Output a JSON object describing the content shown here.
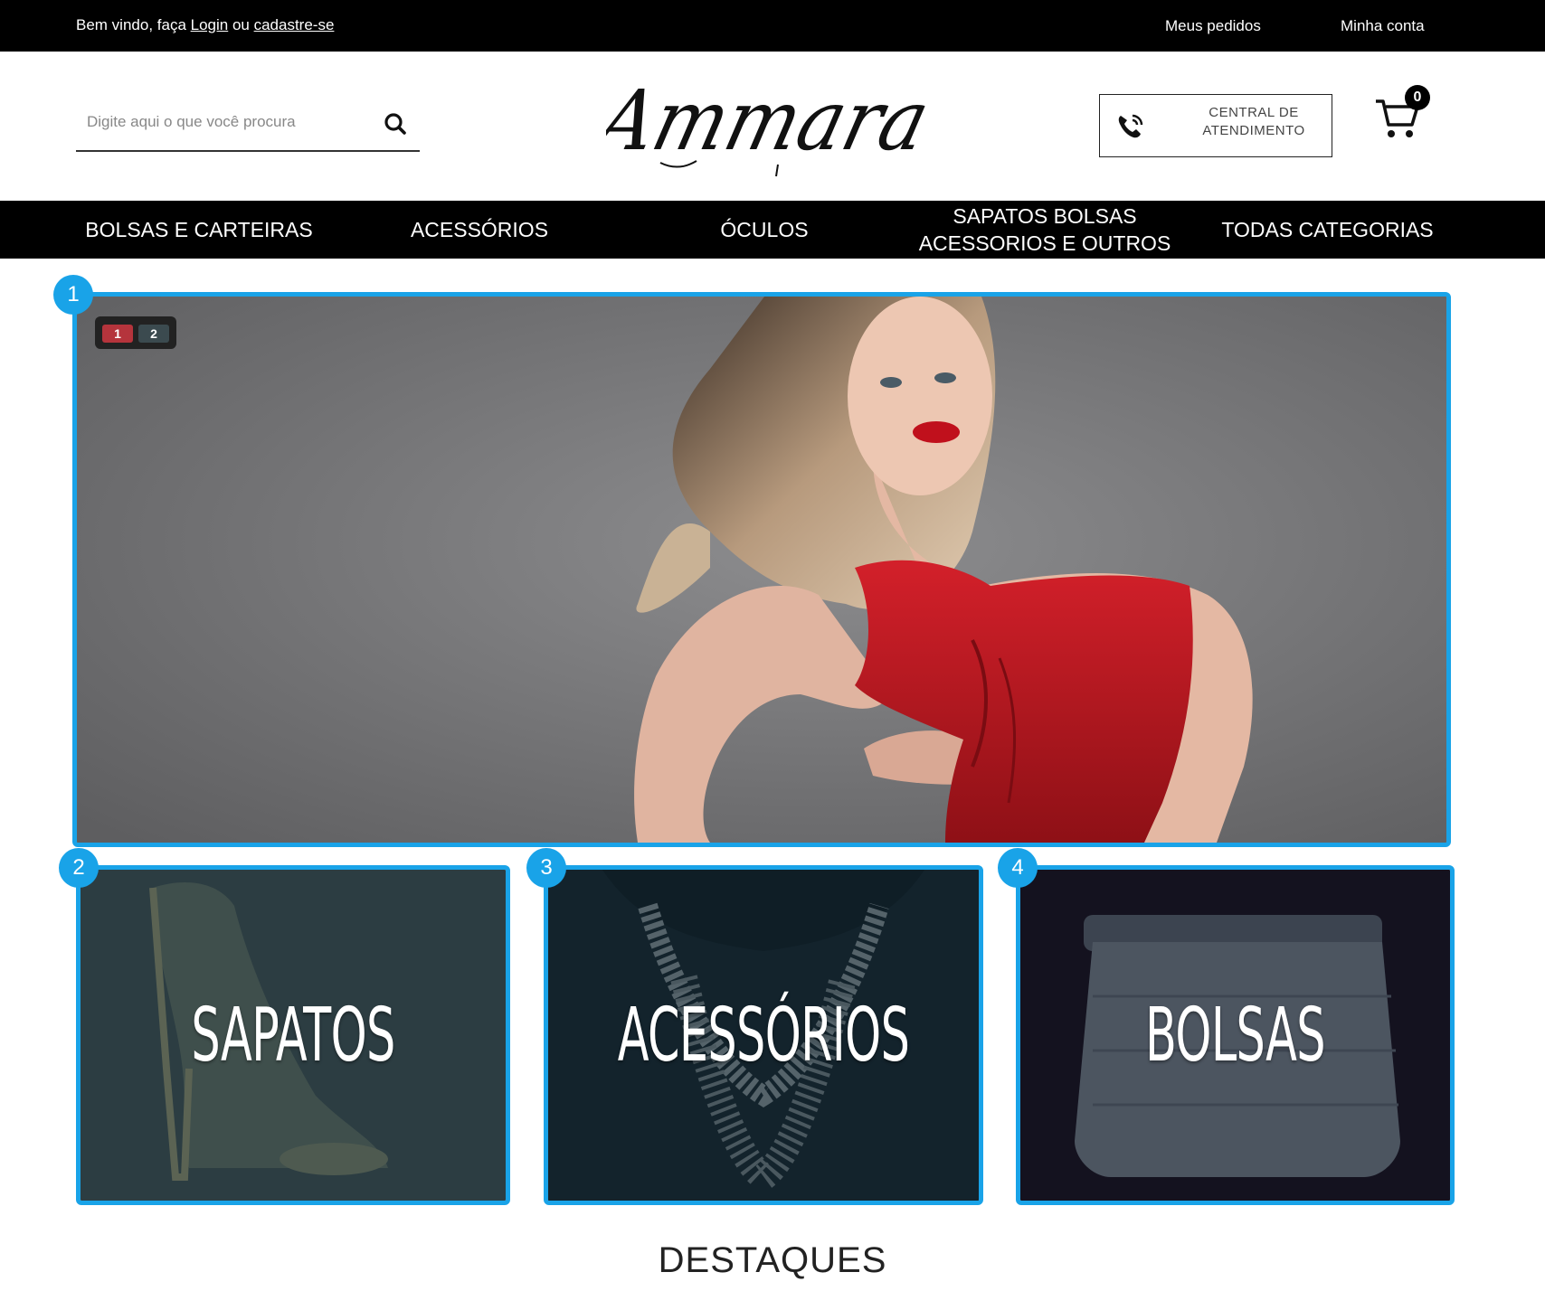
{
  "topbar": {
    "welcome_prefix": "Bem vindo,  faça ",
    "login_label": "Login",
    "or_text": " ou ",
    "signup_label": "cadastre-se",
    "orders_label": "Meus pedidos",
    "account_label": "Minha conta"
  },
  "header": {
    "search_placeholder": "Digite aqui o que você procura",
    "logo_text": "Ammara",
    "support_line1": "CENTRAL DE",
    "support_line2": "ATENDIMENTO",
    "cart_count": "0"
  },
  "nav": {
    "items": [
      {
        "label": "BOLSAS E CARTEIRAS"
      },
      {
        "label": "ACESSÓRIOS"
      },
      {
        "label": "ÓCULOS"
      },
      {
        "label_line1": "SAPATOS BOLSAS",
        "label_line2": "ACESSORIOS E OUTROS"
      },
      {
        "label": "TODAS CATEGORIAS"
      }
    ]
  },
  "hero": {
    "slides": [
      "1",
      "2"
    ],
    "active_slide": 1
  },
  "markers": [
    "1",
    "2",
    "3",
    "4"
  ],
  "tiles": [
    {
      "title": "SAPATOS"
    },
    {
      "title": "ACESSÓRIOS"
    },
    {
      "title": "BOLSAS"
    }
  ],
  "section_title": "DESTAQUES",
  "colors": {
    "highlight": "#19a3e8",
    "active_dot": "#b5343c",
    "inactive_dot": "#3b4a4f"
  }
}
